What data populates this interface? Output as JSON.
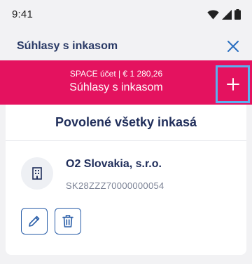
{
  "status_bar": {
    "time": "9:41"
  },
  "header": {
    "title": "Súhlasy s inkasom",
    "close_icon": "close-icon"
  },
  "banner": {
    "subtitle": "SPACE účet | € 1 280,26",
    "title": "Súhlasy s inkasom",
    "add_icon": "plus-icon",
    "color": "#e4125f"
  },
  "card": {
    "heading": "Povolené všetky inkasá",
    "mandate": {
      "company": "O2 Slovakia, s.r.o.",
      "iban": "SK28ZZZ70000000054",
      "icon": "building-icon"
    },
    "actions": {
      "edit_icon": "pencil-icon",
      "delete_icon": "trash-icon"
    }
  },
  "colors": {
    "accent_blue": "#2a5ea8",
    "text_dark": "#1f2d5a",
    "focus_outline": "#5ab0f0"
  }
}
